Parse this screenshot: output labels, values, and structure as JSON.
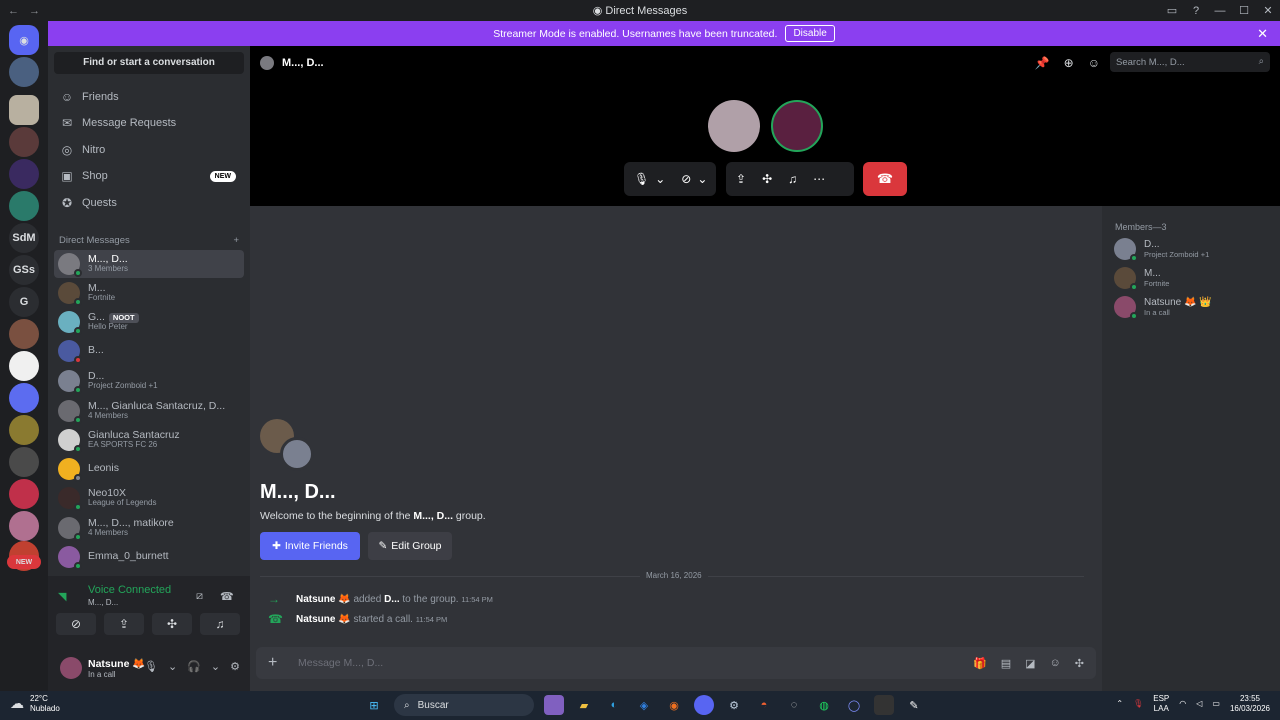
{
  "window": {
    "title": "Direct Messages"
  },
  "banner": {
    "text": "Streamer Mode is enabled. Usernames have been truncated.",
    "button": "Disable"
  },
  "rail": {
    "new_badge": "NEW",
    "servers": [
      "SdM",
      "GSs",
      "G"
    ]
  },
  "sidebar": {
    "search": "Find or start a conversation",
    "nav": [
      {
        "label": "Friends",
        "icon": "friends-icon"
      },
      {
        "label": "Message Requests",
        "icon": "mail-icon"
      },
      {
        "label": "Nitro",
        "icon": "nitro-icon"
      },
      {
        "label": "Shop",
        "icon": "shop-icon",
        "badge": "NEW"
      },
      {
        "label": "Quests",
        "icon": "quests-icon"
      }
    ],
    "dm_header": "Direct Messages",
    "dms": [
      {
        "name": "M..., D...",
        "sub": "3 Members",
        "selected": true
      },
      {
        "name": "M...",
        "sub": "Fortnite"
      },
      {
        "name": "G...",
        "pill": "NOOT",
        "sub": "Hello Peter"
      },
      {
        "name": "B...",
        "sub": ""
      },
      {
        "name": "D...",
        "sub": "Project Zomboid +1"
      },
      {
        "name": "M..., Gianluca Santacruz, D...",
        "sub": "4 Members"
      },
      {
        "name": "Gianluca Santacruz",
        "sub": "EA SPORTS FC 26"
      },
      {
        "name": "Leonis",
        "sub": ""
      },
      {
        "name": "Neo10X",
        "sub": "League of Legends"
      },
      {
        "name": "M..., D..., matikore",
        "sub": "4 Members"
      },
      {
        "name": "Emma_0_burnett",
        "sub": ""
      }
    ]
  },
  "voice": {
    "status": "Voice Connected",
    "channel": "M..., D..."
  },
  "user": {
    "name": "Natsune 🦊",
    "status": "In a call"
  },
  "call": {
    "channel": "M..., D...",
    "search_placeholder": "Search M..., D..."
  },
  "chat": {
    "group_name": "M..., D...",
    "welcome_prefix": "Welcome to the beginning of the ",
    "welcome_name": "M..., D...",
    "welcome_suffix": " group.",
    "invite": "Invite Friends",
    "edit": "Edit Group",
    "date": "March 16, 2026",
    "messages": [
      {
        "user": "Natsune 🦊",
        "action": " added ",
        "target": "D...",
        "rest": " to the group.",
        "time": "11:54 PM"
      },
      {
        "user": "Natsune 🦊",
        "action": " started a call.",
        "target": "",
        "rest": "",
        "time": "11:54 PM"
      }
    ],
    "composer_placeholder": "Message M..., D..."
  },
  "members": {
    "header": "Members—3",
    "list": [
      {
        "name": "D...",
        "sub": "Project Zomboid +1"
      },
      {
        "name": "M...",
        "sub": "Fortnite"
      },
      {
        "name": "Natsune 🦊 👑",
        "sub": "In a call"
      }
    ]
  },
  "taskbar": {
    "temp": "22°C",
    "weather": "Nublado",
    "search": "Buscar",
    "lang": "ESP",
    "lang2": "LAA",
    "time": "23:55",
    "date": "16/03/2026"
  }
}
